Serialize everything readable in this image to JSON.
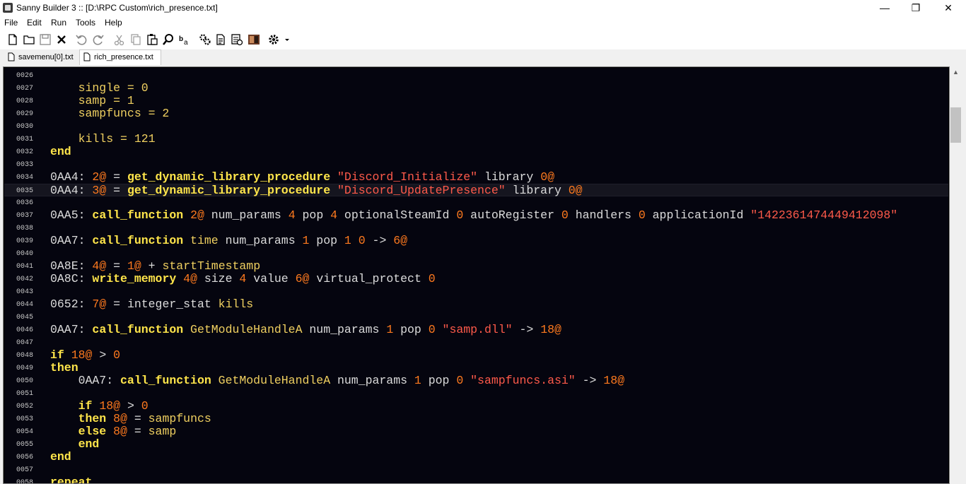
{
  "window": {
    "title": "Sanny Builder 3 :: [D:\\RPC Custom\\rich_presence.txt]"
  },
  "window_controls": {
    "minimize": "—",
    "maximize": "❐",
    "close": "✕"
  },
  "menu": [
    "File",
    "Edit",
    "Run",
    "Tools",
    "Help"
  ],
  "toolbar": [
    "new-file",
    "open-file",
    "save-file",
    "close-file",
    "undo",
    "redo",
    "cut",
    "copy",
    "paste",
    "find",
    "replace",
    "compile",
    "run",
    "options",
    "decompile",
    "settings-dropdown"
  ],
  "tabs": [
    {
      "label": "savemenu[0].txt",
      "active": false
    },
    {
      "label": "rich_presence.txt",
      "active": true
    }
  ],
  "editor": {
    "lines": [
      {
        "num": "0026",
        "tokens": []
      },
      {
        "num": "0027",
        "tokens": [
          {
            "t": "    single = 0",
            "c": "var"
          }
        ]
      },
      {
        "num": "0028",
        "tokens": [
          {
            "t": "    samp = 1",
            "c": "var"
          }
        ]
      },
      {
        "num": "0029",
        "tokens": [
          {
            "t": "    sampfuncs = 2",
            "c": "var"
          }
        ]
      },
      {
        "num": "0030",
        "tokens": []
      },
      {
        "num": "0031",
        "tokens": [
          {
            "t": "    kills = 121",
            "c": "var"
          }
        ]
      },
      {
        "num": "0032",
        "tokens": [
          {
            "t": "end",
            "c": "kw"
          }
        ]
      },
      {
        "num": "0033",
        "tokens": []
      },
      {
        "num": "0034",
        "tokens": [
          {
            "t": "0AA4: ",
            "c": "op"
          },
          {
            "t": "2@",
            "c": "num"
          },
          {
            "t": " = ",
            "c": "op"
          },
          {
            "t": "get_dynamic_library_procedure",
            "c": "kw"
          },
          {
            "t": " ",
            "c": "op"
          },
          {
            "t": "\"Discord_Initialize\"",
            "c": "str"
          },
          {
            "t": " library ",
            "c": "op"
          },
          {
            "t": "0@",
            "c": "num"
          }
        ]
      },
      {
        "num": "0035",
        "current": true,
        "tokens": [
          {
            "t": "0AA4: ",
            "c": "op"
          },
          {
            "t": "3@",
            "c": "num"
          },
          {
            "t": " = ",
            "c": "op"
          },
          {
            "t": "get_dynamic_library_procedure",
            "c": "kw"
          },
          {
            "t": " ",
            "c": "op"
          },
          {
            "t": "\"Discord_UpdatePresence\"",
            "c": "str"
          },
          {
            "t": " library ",
            "c": "op"
          },
          {
            "t": "0@",
            "c": "num"
          }
        ]
      },
      {
        "num": "0036",
        "tokens": []
      },
      {
        "num": "0037",
        "tokens": [
          {
            "t": "0AA5: ",
            "c": "op"
          },
          {
            "t": "call_function",
            "c": "kw"
          },
          {
            "t": " ",
            "c": "op"
          },
          {
            "t": "2@",
            "c": "num"
          },
          {
            "t": " num_params ",
            "c": "op"
          },
          {
            "t": "4",
            "c": "num"
          },
          {
            "t": " pop ",
            "c": "op"
          },
          {
            "t": "4",
            "c": "num"
          },
          {
            "t": " optionalSteamId ",
            "c": "op"
          },
          {
            "t": "0",
            "c": "num"
          },
          {
            "t": " autoRegister ",
            "c": "op"
          },
          {
            "t": "0",
            "c": "num"
          },
          {
            "t": " handlers ",
            "c": "op"
          },
          {
            "t": "0",
            "c": "num"
          },
          {
            "t": " applicationId ",
            "c": "op"
          },
          {
            "t": "\"1422361474449412098\"",
            "c": "str"
          }
        ]
      },
      {
        "num": "0038",
        "tokens": []
      },
      {
        "num": "0039",
        "tokens": [
          {
            "t": "0AA7: ",
            "c": "op"
          },
          {
            "t": "call_function",
            "c": "kw"
          },
          {
            "t": " time",
            "c": "var"
          },
          {
            "t": " num_params ",
            "c": "op"
          },
          {
            "t": "1",
            "c": "num"
          },
          {
            "t": " pop ",
            "c": "op"
          },
          {
            "t": "1",
            "c": "num"
          },
          {
            "t": " ",
            "c": "op"
          },
          {
            "t": "0",
            "c": "num"
          },
          {
            "t": " -> ",
            "c": "op"
          },
          {
            "t": "6@",
            "c": "num"
          }
        ]
      },
      {
        "num": "0040",
        "tokens": []
      },
      {
        "num": "0041",
        "tokens": [
          {
            "t": "0A8E: ",
            "c": "op"
          },
          {
            "t": "4@",
            "c": "num"
          },
          {
            "t": " = ",
            "c": "op"
          },
          {
            "t": "1@",
            "c": "num"
          },
          {
            "t": " + ",
            "c": "op"
          },
          {
            "t": "startTimestamp",
            "c": "var"
          }
        ]
      },
      {
        "num": "0042",
        "tokens": [
          {
            "t": "0A8C: ",
            "c": "op"
          },
          {
            "t": "write_memory",
            "c": "kw"
          },
          {
            "t": " ",
            "c": "op"
          },
          {
            "t": "4@",
            "c": "num"
          },
          {
            "t": " size ",
            "c": "op"
          },
          {
            "t": "4",
            "c": "num"
          },
          {
            "t": " value ",
            "c": "op"
          },
          {
            "t": "6@",
            "c": "num"
          },
          {
            "t": " virtual_protect ",
            "c": "op"
          },
          {
            "t": "0",
            "c": "num"
          }
        ]
      },
      {
        "num": "0043",
        "tokens": []
      },
      {
        "num": "0044",
        "tokens": [
          {
            "t": "0652: ",
            "c": "op"
          },
          {
            "t": "7@",
            "c": "num"
          },
          {
            "t": " = integer_stat ",
            "c": "op"
          },
          {
            "t": "kills",
            "c": "var"
          }
        ]
      },
      {
        "num": "0045",
        "tokens": []
      },
      {
        "num": "0046",
        "tokens": [
          {
            "t": "0AA7: ",
            "c": "op"
          },
          {
            "t": "call_function",
            "c": "kw"
          },
          {
            "t": " GetModuleHandleA",
            "c": "var"
          },
          {
            "t": " num_params ",
            "c": "op"
          },
          {
            "t": "1",
            "c": "num"
          },
          {
            "t": " pop ",
            "c": "op"
          },
          {
            "t": "0",
            "c": "num"
          },
          {
            "t": " ",
            "c": "op"
          },
          {
            "t": "\"samp.dll\"",
            "c": "str"
          },
          {
            "t": " -> ",
            "c": "op"
          },
          {
            "t": "18@",
            "c": "num"
          }
        ]
      },
      {
        "num": "0047",
        "tokens": []
      },
      {
        "num": "0048",
        "tokens": [
          {
            "t": "if",
            "c": "kw"
          },
          {
            "t": " ",
            "c": "op"
          },
          {
            "t": "18@",
            "c": "num"
          },
          {
            "t": " > ",
            "c": "op"
          },
          {
            "t": "0",
            "c": "num"
          }
        ]
      },
      {
        "num": "0049",
        "tokens": [
          {
            "t": "then",
            "c": "kw"
          }
        ]
      },
      {
        "num": "0050",
        "tokens": [
          {
            "t": "    0AA7: ",
            "c": "op"
          },
          {
            "t": "call_function",
            "c": "kw"
          },
          {
            "t": " GetModuleHandleA",
            "c": "var"
          },
          {
            "t": " num_params ",
            "c": "op"
          },
          {
            "t": "1",
            "c": "num"
          },
          {
            "t": " pop ",
            "c": "op"
          },
          {
            "t": "0",
            "c": "num"
          },
          {
            "t": " ",
            "c": "op"
          },
          {
            "t": "\"sampfuncs.asi\"",
            "c": "str"
          },
          {
            "t": " -> ",
            "c": "op"
          },
          {
            "t": "18@",
            "c": "num"
          }
        ]
      },
      {
        "num": "0051",
        "tokens": []
      },
      {
        "num": "0052",
        "tokens": [
          {
            "t": "    if",
            "c": "kw"
          },
          {
            "t": " ",
            "c": "op"
          },
          {
            "t": "18@",
            "c": "num"
          },
          {
            "t": " > ",
            "c": "op"
          },
          {
            "t": "0",
            "c": "num"
          }
        ]
      },
      {
        "num": "0053",
        "tokens": [
          {
            "t": "    then",
            "c": "kw"
          },
          {
            "t": " ",
            "c": "op"
          },
          {
            "t": "8@",
            "c": "num"
          },
          {
            "t": " = ",
            "c": "op"
          },
          {
            "t": "sampfuncs",
            "c": "var"
          }
        ]
      },
      {
        "num": "0054",
        "tokens": [
          {
            "t": "    else",
            "c": "kw"
          },
          {
            "t": " ",
            "c": "op"
          },
          {
            "t": "8@",
            "c": "num"
          },
          {
            "t": " = ",
            "c": "op"
          },
          {
            "t": "samp",
            "c": "var"
          }
        ]
      },
      {
        "num": "0055",
        "tokens": [
          {
            "t": "    end",
            "c": "kw"
          }
        ]
      },
      {
        "num": "0056",
        "tokens": [
          {
            "t": "end",
            "c": "kw"
          }
        ]
      },
      {
        "num": "0057",
        "tokens": []
      },
      {
        "num": "0058",
        "tokens": [
          {
            "t": "repeat",
            "c": "kw"
          }
        ]
      }
    ]
  },
  "colors": {
    "editor_bg": "#05050f",
    "current_line_bg": "#15151f",
    "keyword": "#ffe54a",
    "variable": "#f0d060",
    "operator": "#dcdcdc",
    "number": "#ff7a1e",
    "string": "#ff5a4a",
    "line_number": "#c8c8c8"
  },
  "scrollbar": {
    "up_arrow": "▲",
    "down_arrow": "▼"
  }
}
